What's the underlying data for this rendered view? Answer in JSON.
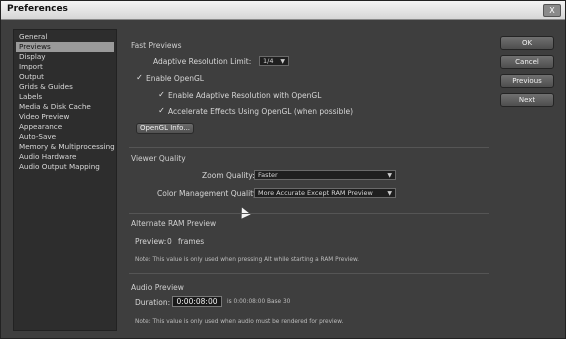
{
  "window": {
    "title": "Preferences",
    "close_label": "X"
  },
  "sidebar": {
    "items": [
      {
        "label": "General"
      },
      {
        "label": "Previews"
      },
      {
        "label": "Display"
      },
      {
        "label": "Import"
      },
      {
        "label": "Output"
      },
      {
        "label": "Grids & Guides"
      },
      {
        "label": "Labels"
      },
      {
        "label": "Media & Disk Cache"
      },
      {
        "label": "Video Preview"
      },
      {
        "label": "Appearance"
      },
      {
        "label": "Auto-Save"
      },
      {
        "label": "Memory & Multiprocessing"
      },
      {
        "label": "Audio Hardware"
      },
      {
        "label": "Audio Output Mapping"
      }
    ],
    "selected": "Previews"
  },
  "fast_previews": {
    "section_title": "Fast Previews",
    "adaptive_label": "Adaptive Resolution Limit:",
    "adaptive_value": "1/4",
    "enable_opengl": "Enable OpenGL",
    "enable_adaptive_opengl": "Enable Adaptive Resolution with OpenGL",
    "accelerate_effects": "Accelerate Effects Using OpenGL (when possible)",
    "opengl_info_button": "OpenGL Info..."
  },
  "viewer_quality": {
    "section_title": "Viewer Quality",
    "zoom_label": "Zoom Quality:",
    "zoom_value": "Faster",
    "color_label": "Color Management Quality:",
    "color_value": "More Accurate Except RAM Preview"
  },
  "alt_ram": {
    "section_title": "Alternate RAM Preview",
    "preview_label": "Preview:",
    "preview_value": "0",
    "frames_label": "frames",
    "note": "Note: This value is only used when pressing Alt while starting a RAM Preview."
  },
  "audio_preview": {
    "section_title": "Audio Preview",
    "duration_label": "Duration:",
    "duration_value": "0:00:08:00",
    "duration_info": "is 0:00:08:00 Base 30",
    "note": "Note: This value is only used when audio must be rendered for preview."
  },
  "buttons": {
    "ok": "OK",
    "cancel": "Cancel",
    "previous": "Previous",
    "next": "Next"
  },
  "icons": {
    "checkmark": "check-icon",
    "dropdown": "chevron-down-icon",
    "cursor": "mouse-pointer-icon"
  }
}
